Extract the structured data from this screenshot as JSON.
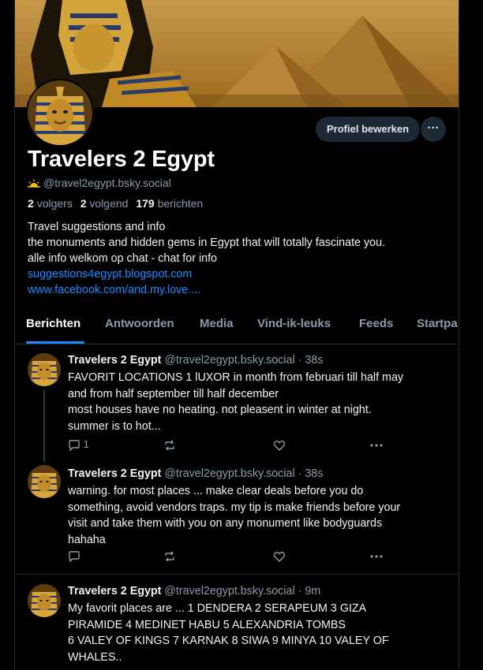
{
  "profile": {
    "display_name": "Travelers 2 Egypt",
    "handle": "@travel2egypt.bsky.social",
    "followers_count": "2",
    "followers_label": "volgers",
    "following_count": "2",
    "following_label": "volgend",
    "posts_count": "179",
    "posts_label": "berichten",
    "bio_lines": [
      "Travel suggestions and info",
      "the monuments and hidden gems in Egypt that will totally fascinate you.",
      "alle info welkom op chat - chat for info"
    ],
    "links": [
      "suggestions4egypt.blogspot.com",
      "www.facebook.com/and.my.love...."
    ]
  },
  "buttons": {
    "edit_profile": "Profiel bewerken",
    "more": "···"
  },
  "tabs": [
    {
      "label": "Berichten",
      "active": true
    },
    {
      "label": "Antwoorden",
      "active": false
    },
    {
      "label": "Media",
      "active": false
    },
    {
      "label": "Vind-ik-leuks",
      "active": false
    },
    {
      "label": "Feeds",
      "active": false
    },
    {
      "label": "Startpa",
      "active": false
    }
  ],
  "posts": [
    {
      "name": "Travelers 2 Egypt",
      "meta": "@travel2egypt.bsky.social · 38s",
      "lines": [
        "FAVORIT LOCATIONS  1 lUXOR  in month from februari till half may",
        "and from half september till half december",
        "most houses have no heating. not pleasent in winter at night.",
        "summer is to hot..."
      ],
      "reply_count": "1"
    },
    {
      "name": "Travelers 2 Egypt",
      "meta": "@travel2egypt.bsky.social · 38s",
      "lines": [
        "warning. for most places ... make clear deals before you do",
        "something, avoid vendors traps. my tip is make friends before your",
        "visit and take them with you on any monument like bodyguards",
        "hahaha"
      ],
      "reply_count": ""
    },
    {
      "name": "Travelers 2 Egypt",
      "meta": "@travel2egypt.bsky.social · 9m",
      "lines": [
        "My favorit places are ... 1 DENDERA 2 SERAPEUM  3 GIZA",
        "PIRAMIDE 4 MEDINET HABU 5 ALEXANDRIA TOMBS",
        "6 VALEY OF KINGS 7 KARNAK 8 SIWA 9 MINYA 10 VALEY OF",
        "WHALES.."
      ]
    }
  ],
  "colors": {
    "accent": "#208bfe",
    "muted": "#8d9aa9",
    "background": "#000000",
    "button_bg": "#1e2936"
  },
  "icons": [
    "reply-icon",
    "repost-icon",
    "like-icon",
    "more-icon",
    "sun-icon"
  ]
}
